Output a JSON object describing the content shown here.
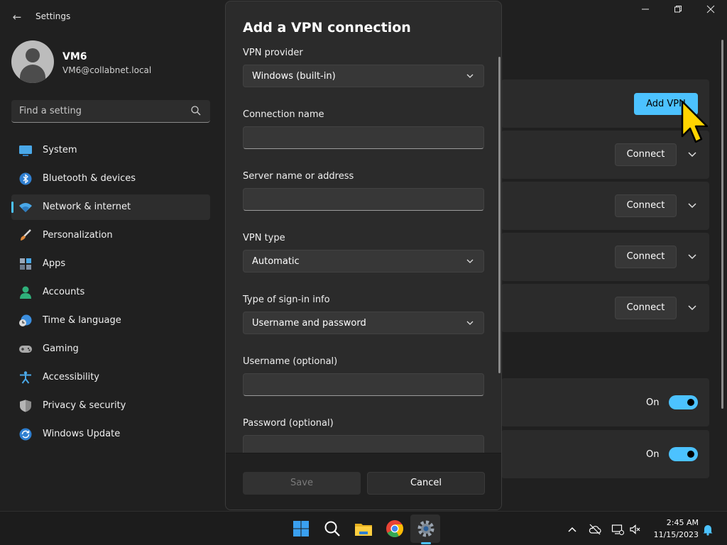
{
  "window": {
    "title": "Settings",
    "back_glyph": "←"
  },
  "user": {
    "name": "VM6",
    "email": "VM6@collabnet.local"
  },
  "search": {
    "placeholder": "Find a setting"
  },
  "nav": [
    {
      "label": "System",
      "icon": "monitor-icon"
    },
    {
      "label": "Bluetooth & devices",
      "icon": "bluetooth-icon"
    },
    {
      "label": "Network & internet",
      "icon": "wifi-icon",
      "active": true
    },
    {
      "label": "Personalization",
      "icon": "brush-icon"
    },
    {
      "label": "Apps",
      "icon": "apps-icon"
    },
    {
      "label": "Accounts",
      "icon": "person-icon"
    },
    {
      "label": "Time & language",
      "icon": "globe-clock-icon"
    },
    {
      "label": "Gaming",
      "icon": "gamepad-icon"
    },
    {
      "label": "Accessibility",
      "icon": "accessibility-icon"
    },
    {
      "label": "Privacy & security",
      "icon": "shield-icon"
    },
    {
      "label": "Windows Update",
      "icon": "update-icon"
    }
  ],
  "background": {
    "add_vpn_label": "Add VPN",
    "connect_label": "Connect",
    "on_label": "On"
  },
  "dialog": {
    "title": "Add a VPN connection",
    "vpn_provider_label": "VPN provider",
    "vpn_provider_value": "Windows (built-in)",
    "connection_name_label": "Connection name",
    "connection_name_value": "",
    "server_label": "Server name or address",
    "server_value": "",
    "vpn_type_label": "VPN type",
    "vpn_type_value": "Automatic",
    "signin_label": "Type of sign-in info",
    "signin_value": "Username and password",
    "username_label": "Username (optional)",
    "username_value": "",
    "password_label": "Password (optional)",
    "save_label": "Save",
    "cancel_label": "Cancel"
  },
  "taskbar": {
    "time": "2:45 AM",
    "date": "11/15/2023"
  },
  "colors": {
    "accent": "#4cc2ff",
    "cursor": "#ffd400"
  }
}
